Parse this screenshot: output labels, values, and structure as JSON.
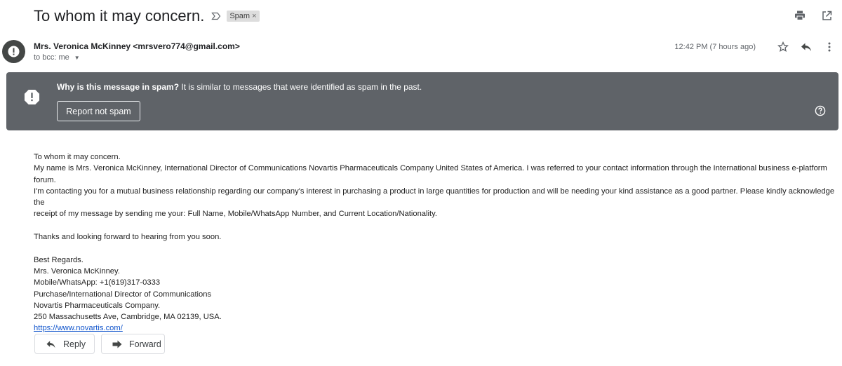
{
  "message": {
    "subject": "To whom it may concern.",
    "label": "Spam",
    "label_remove": "×",
    "sender": "Mrs. Veronica McKinney <mrsvero774@gmail.com>",
    "recipient_prefix": "to bcc: me",
    "timestamp": "12:42 PM (7 hours ago)"
  },
  "spam_banner": {
    "question": "Why is this message in spam?",
    "explanation": " It is similar to messages that were identified as spam in the past.",
    "report_button": "Report not spam"
  },
  "body": {
    "line1": "To whom it may concern.",
    "line2": "My name is  Mrs. Veronica McKinney, International Director of Communications  Novartis Pharmaceuticals Company United States of America. I was referred to your contact information through the International business e-platform forum.",
    "line3": "I'm contacting you for a mutual business relationship regarding our company's interest in purchasing a product in large quantities for production and will be needing your kind assistance as a good partner. Please kindly acknowledge the",
    "line4": "receipt of my message by sending me your: Full Name, Mobile/WhatsApp Number, and Current Location/Nationality.",
    "line5": "Thanks and looking forward to hearing from you soon.",
    "sig1": "Best Regards.",
    "sig2": "Mrs. Veronica McKinney.",
    "sig3": "Mobile/WhatsApp: +1(619)317-0333",
    "sig4": "Purchase/International Director of Communications",
    "sig5": "Novartis Pharmaceuticals Company.",
    "sig6": "250 Massachusetts Ave, Cambridge, MA 02139, USA.",
    "link": "https://www.novartis.com/"
  },
  "actions": {
    "reply": "Reply",
    "forward": "Forward"
  },
  "colors": {
    "banner": "#5f6368",
    "link": "#1155cc",
    "chip": "#dddddd"
  }
}
